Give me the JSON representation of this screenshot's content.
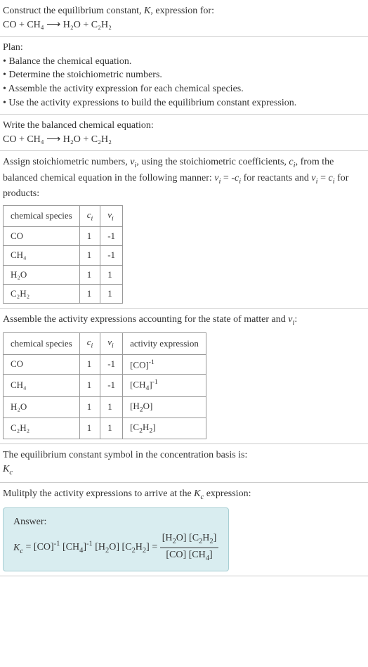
{
  "problem": {
    "instruction": "Construct the equilibrium constant, K, expression for:",
    "equation_unbalanced": "CO + CH₄  ⟶  H₂O + C₂H₂"
  },
  "plan": {
    "title": "Plan:",
    "steps": [
      "• Balance the chemical equation.",
      "• Determine the stoichiometric numbers.",
      "• Assemble the activity expression for each chemical species.",
      "• Use the activity expressions to build the equilibrium constant expression."
    ]
  },
  "balanced": {
    "instruction": "Write the balanced chemical equation:",
    "equation": "CO + CH₄  ⟶  H₂O + C₂H₂"
  },
  "stoich": {
    "instruction_a": "Assign stoichiometric numbers, νᵢ, using the stoichiometric coefficients, cᵢ, from the balanced chemical equation in the following manner: νᵢ = -cᵢ for reactants and νᵢ = cᵢ for products:",
    "headers": [
      "chemical species",
      "cᵢ",
      "νᵢ"
    ],
    "rows": [
      {
        "species": "CO",
        "c": "1",
        "v": "-1"
      },
      {
        "species": "CH₄",
        "c": "1",
        "v": "-1"
      },
      {
        "species": "H₂O",
        "c": "1",
        "v": "1"
      },
      {
        "species": "C₂H₂",
        "c": "1",
        "v": "1"
      }
    ]
  },
  "activity": {
    "instruction": "Assemble the activity expressions accounting for the state of matter and νᵢ:",
    "headers": [
      "chemical species",
      "cᵢ",
      "νᵢ",
      "activity expression"
    ],
    "rows": [
      {
        "species": "CO",
        "c": "1",
        "v": "-1",
        "expr": "[CO]⁻¹"
      },
      {
        "species": "CH₄",
        "c": "1",
        "v": "-1",
        "expr": "[CH₄]⁻¹"
      },
      {
        "species": "H₂O",
        "c": "1",
        "v": "1",
        "expr": "[H₂O]"
      },
      {
        "species": "C₂H₂",
        "c": "1",
        "v": "1",
        "expr": "[C₂H₂]"
      }
    ]
  },
  "symbol": {
    "line1": "The equilibrium constant symbol in the concentration basis is:",
    "line2": "K_c"
  },
  "final": {
    "instruction": "Mulitply the activity expressions to arrive at the K_c expression:",
    "answer_label": "Answer:",
    "lhs": "K_c = [CO]⁻¹ [CH₄]⁻¹ [H₂O] [C₂H₂] = ",
    "frac_num": "[H₂O] [C₂H₂]",
    "frac_den": "[CO] [CH₄]"
  },
  "chart_data": {
    "type": "table",
    "tables": [
      {
        "title": "Stoichiometric numbers",
        "columns": [
          "chemical species",
          "c_i",
          "nu_i"
        ],
        "rows": [
          [
            "CO",
            1,
            -1
          ],
          [
            "CH4",
            1,
            -1
          ],
          [
            "H2O",
            1,
            1
          ],
          [
            "C2H2",
            1,
            1
          ]
        ]
      },
      {
        "title": "Activity expressions",
        "columns": [
          "chemical species",
          "c_i",
          "nu_i",
          "activity expression"
        ],
        "rows": [
          [
            "CO",
            1,
            -1,
            "[CO]^-1"
          ],
          [
            "CH4",
            1,
            -1,
            "[CH4]^-1"
          ],
          [
            "H2O",
            1,
            1,
            "[H2O]"
          ],
          [
            "C2H2",
            1,
            1,
            "[C2H2]"
          ]
        ]
      }
    ]
  }
}
